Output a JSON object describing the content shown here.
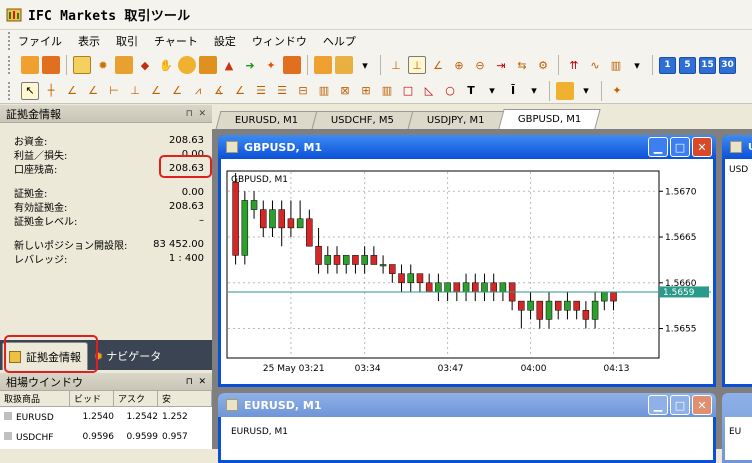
{
  "window": {
    "title": "IFC Markets 取引ツール"
  },
  "menu": [
    "ファイル",
    "表示",
    "取引",
    "チャート",
    "設定",
    "ウィンドウ",
    "ヘルプ"
  ],
  "timeframes": [
    "1",
    "5",
    "15",
    "30"
  ],
  "account": {
    "header": "証拠金情報",
    "rows1": [
      {
        "label": "お資金:",
        "value": "208.63"
      },
      {
        "label": "利益／損失:",
        "value": "0.00"
      },
      {
        "label": "口座残高:",
        "value": "208.63"
      }
    ],
    "rows2": [
      {
        "label": "証拠金:",
        "value": "0.00"
      },
      {
        "label": "有効証拠金:",
        "value": "208.63"
      },
      {
        "label": "証拠金レベル:",
        "value": "–"
      }
    ],
    "rows3": [
      {
        "label": "新しいポジション開設限:",
        "value": "83 452.00"
      },
      {
        "label": "レバレッジ:",
        "value": "1 : 400"
      }
    ]
  },
  "panel_tabs": {
    "tab1": "証拠金情報",
    "tab2": "ナビゲータ"
  },
  "market_watch": {
    "header": "相場ウインドウ",
    "columns": [
      "取扱商品",
      "ビッド",
      "アスク",
      "安"
    ],
    "rows": [
      {
        "symbol": "EURUSD",
        "bid": "1.2540",
        "ask": "1.2542",
        "low": "1.252"
      },
      {
        "symbol": "USDCHF",
        "bid": "0.9596",
        "ask": "0.9599",
        "low": "0.957"
      }
    ]
  },
  "chart_tabs": [
    "EURUSD, M1",
    "USDCHF, M5",
    "USDJPY, M1",
    "GBPUSD, M1"
  ],
  "gbp_window": {
    "title": "GBPUSD, M1",
    "chart_label": "GBPUSD, M1",
    "current_price": "1.5659"
  },
  "eur_window": {
    "title": "EURUSD, M1",
    "chart_label": "EURUSD, M1"
  },
  "colors": {
    "up": "#2ca02c",
    "down": "#d62728",
    "price_line": "#2a9a8a",
    "accent": "#0a4fd8",
    "highlight": "#e02020"
  },
  "chart_data": {
    "type": "candlestick",
    "symbol": "GBPUSD",
    "timeframe": "M1",
    "y_ticks": [
      "1.5670",
      "1.5665",
      "1.5660",
      "1.5655"
    ],
    "x_ticks": [
      "25 May 03:21",
      "03:34",
      "03:47",
      "04:00",
      "04:13"
    ],
    "ylim": [
      1.5652,
      1.5672
    ],
    "current_price": 1.5659,
    "candles": [
      {
        "o": 1.5671,
        "c": 1.5663,
        "h": 1.5672,
        "l": 1.5662
      },
      {
        "o": 1.5663,
        "c": 1.5669,
        "h": 1.567,
        "l": 1.5662
      },
      {
        "o": 1.5668,
        "c": 1.5669,
        "h": 1.567,
        "l": 1.5667
      },
      {
        "o": 1.5668,
        "c": 1.5666,
        "h": 1.5669,
        "l": 1.5665
      },
      {
        "o": 1.5666,
        "c": 1.5668,
        "h": 1.5669,
        "l": 1.5665
      },
      {
        "o": 1.5668,
        "c": 1.5666,
        "h": 1.5669,
        "l": 1.5664
      },
      {
        "o": 1.5667,
        "c": 1.5666,
        "h": 1.5669,
        "l": 1.5665
      },
      {
        "o": 1.5666,
        "c": 1.5667,
        "h": 1.5669,
        "l": 1.5666
      },
      {
        "o": 1.5667,
        "c": 1.5664,
        "h": 1.5668,
        "l": 1.5664
      },
      {
        "o": 1.5664,
        "c": 1.5662,
        "h": 1.5666,
        "l": 1.5661
      },
      {
        "o": 1.5662,
        "c": 1.5663,
        "h": 1.5664,
        "l": 1.5661
      },
      {
        "o": 1.5663,
        "c": 1.5662,
        "h": 1.5664,
        "l": 1.5661
      },
      {
        "o": 1.5662,
        "c": 1.5663,
        "h": 1.5663,
        "l": 1.5661
      },
      {
        "o": 1.5663,
        "c": 1.5662,
        "h": 1.5663,
        "l": 1.5661
      },
      {
        "o": 1.5662,
        "c": 1.5663,
        "h": 1.5664,
        "l": 1.5661
      },
      {
        "o": 1.5663,
        "c": 1.5662,
        "h": 1.5664,
        "l": 1.5662
      },
      {
        "o": 1.5662,
        "c": 1.5662,
        "h": 1.5663,
        "l": 1.5661
      },
      {
        "o": 1.5662,
        "c": 1.5661,
        "h": 1.5662,
        "l": 1.566
      },
      {
        "o": 1.5661,
        "c": 1.566,
        "h": 1.5662,
        "l": 1.5659
      },
      {
        "o": 1.566,
        "c": 1.5661,
        "h": 1.5662,
        "l": 1.5659
      },
      {
        "o": 1.5661,
        "c": 1.566,
        "h": 1.5661,
        "l": 1.5659
      },
      {
        "o": 1.566,
        "c": 1.5659,
        "h": 1.5661,
        "l": 1.5659
      },
      {
        "o": 1.5659,
        "c": 1.566,
        "h": 1.5661,
        "l": 1.5658
      },
      {
        "o": 1.5659,
        "c": 1.566,
        "h": 1.566,
        "l": 1.5658
      },
      {
        "o": 1.566,
        "c": 1.5659,
        "h": 1.566,
        "l": 1.5658
      },
      {
        "o": 1.5659,
        "c": 1.566,
        "h": 1.5661,
        "l": 1.5658
      },
      {
        "o": 1.566,
        "c": 1.5659,
        "h": 1.5661,
        "l": 1.5658
      },
      {
        "o": 1.5659,
        "c": 1.566,
        "h": 1.5661,
        "l": 1.5658
      },
      {
        "o": 1.566,
        "c": 1.5659,
        "h": 1.5661,
        "l": 1.5658
      },
      {
        "o": 1.5659,
        "c": 1.566,
        "h": 1.566,
        "l": 1.5658
      },
      {
        "o": 1.566,
        "c": 1.5658,
        "h": 1.566,
        "l": 1.5657
      },
      {
        "o": 1.5658,
        "c": 1.5657,
        "h": 1.5658,
        "l": 1.5655
      },
      {
        "o": 1.5657,
        "c": 1.5658,
        "h": 1.5659,
        "l": 1.5656
      },
      {
        "o": 1.5658,
        "c": 1.5656,
        "h": 1.5658,
        "l": 1.5655
      },
      {
        "o": 1.5656,
        "c": 1.5658,
        "h": 1.5659,
        "l": 1.5655
      },
      {
        "o": 1.5658,
        "c": 1.5657,
        "h": 1.5658,
        "l": 1.5656
      },
      {
        "o": 1.5657,
        "c": 1.5658,
        "h": 1.5659,
        "l": 1.5656
      },
      {
        "o": 1.5658,
        "c": 1.5657,
        "h": 1.5658,
        "l": 1.5656
      },
      {
        "o": 1.5657,
        "c": 1.5656,
        "h": 1.5658,
        "l": 1.5655
      },
      {
        "o": 1.5656,
        "c": 1.5658,
        "h": 1.5659,
        "l": 1.5655
      },
      {
        "o": 1.5658,
        "c": 1.5659,
        "h": 1.5659,
        "l": 1.5657
      },
      {
        "o": 1.5659,
        "c": 1.5658,
        "h": 1.5659,
        "l": 1.5657
      }
    ]
  }
}
